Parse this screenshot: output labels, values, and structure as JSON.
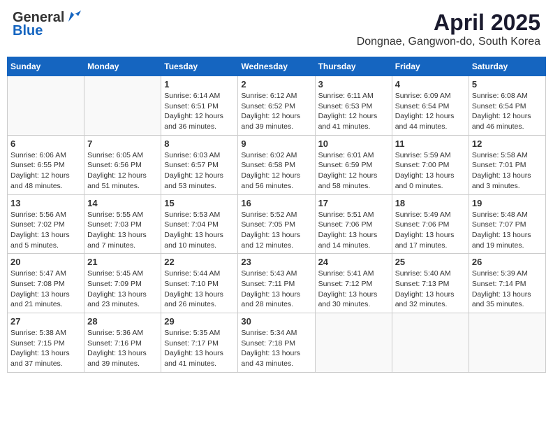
{
  "header": {
    "logo_general": "General",
    "logo_blue": "Blue",
    "title": "April 2025",
    "location": "Dongnae, Gangwon-do, South Korea"
  },
  "calendar": {
    "weekdays": [
      "Sunday",
      "Monday",
      "Tuesday",
      "Wednesday",
      "Thursday",
      "Friday",
      "Saturday"
    ],
    "days": [
      {
        "date": "",
        "info": ""
      },
      {
        "date": "",
        "info": ""
      },
      {
        "date": "1",
        "info": "Sunrise: 6:14 AM\nSunset: 6:51 PM\nDaylight: 12 hours and 36 minutes."
      },
      {
        "date": "2",
        "info": "Sunrise: 6:12 AM\nSunset: 6:52 PM\nDaylight: 12 hours and 39 minutes."
      },
      {
        "date": "3",
        "info": "Sunrise: 6:11 AM\nSunset: 6:53 PM\nDaylight: 12 hours and 41 minutes."
      },
      {
        "date": "4",
        "info": "Sunrise: 6:09 AM\nSunset: 6:54 PM\nDaylight: 12 hours and 44 minutes."
      },
      {
        "date": "5",
        "info": "Sunrise: 6:08 AM\nSunset: 6:54 PM\nDaylight: 12 hours and 46 minutes."
      },
      {
        "date": "6",
        "info": "Sunrise: 6:06 AM\nSunset: 6:55 PM\nDaylight: 12 hours and 48 minutes."
      },
      {
        "date": "7",
        "info": "Sunrise: 6:05 AM\nSunset: 6:56 PM\nDaylight: 12 hours and 51 minutes."
      },
      {
        "date": "8",
        "info": "Sunrise: 6:03 AM\nSunset: 6:57 PM\nDaylight: 12 hours and 53 minutes."
      },
      {
        "date": "9",
        "info": "Sunrise: 6:02 AM\nSunset: 6:58 PM\nDaylight: 12 hours and 56 minutes."
      },
      {
        "date": "10",
        "info": "Sunrise: 6:01 AM\nSunset: 6:59 PM\nDaylight: 12 hours and 58 minutes."
      },
      {
        "date": "11",
        "info": "Sunrise: 5:59 AM\nSunset: 7:00 PM\nDaylight: 13 hours and 0 minutes."
      },
      {
        "date": "12",
        "info": "Sunrise: 5:58 AM\nSunset: 7:01 PM\nDaylight: 13 hours and 3 minutes."
      },
      {
        "date": "13",
        "info": "Sunrise: 5:56 AM\nSunset: 7:02 PM\nDaylight: 13 hours and 5 minutes."
      },
      {
        "date": "14",
        "info": "Sunrise: 5:55 AM\nSunset: 7:03 PM\nDaylight: 13 hours and 7 minutes."
      },
      {
        "date": "15",
        "info": "Sunrise: 5:53 AM\nSunset: 7:04 PM\nDaylight: 13 hours and 10 minutes."
      },
      {
        "date": "16",
        "info": "Sunrise: 5:52 AM\nSunset: 7:05 PM\nDaylight: 13 hours and 12 minutes."
      },
      {
        "date": "17",
        "info": "Sunrise: 5:51 AM\nSunset: 7:06 PM\nDaylight: 13 hours and 14 minutes."
      },
      {
        "date": "18",
        "info": "Sunrise: 5:49 AM\nSunset: 7:06 PM\nDaylight: 13 hours and 17 minutes."
      },
      {
        "date": "19",
        "info": "Sunrise: 5:48 AM\nSunset: 7:07 PM\nDaylight: 13 hours and 19 minutes."
      },
      {
        "date": "20",
        "info": "Sunrise: 5:47 AM\nSunset: 7:08 PM\nDaylight: 13 hours and 21 minutes."
      },
      {
        "date": "21",
        "info": "Sunrise: 5:45 AM\nSunset: 7:09 PM\nDaylight: 13 hours and 23 minutes."
      },
      {
        "date": "22",
        "info": "Sunrise: 5:44 AM\nSunset: 7:10 PM\nDaylight: 13 hours and 26 minutes."
      },
      {
        "date": "23",
        "info": "Sunrise: 5:43 AM\nSunset: 7:11 PM\nDaylight: 13 hours and 28 minutes."
      },
      {
        "date": "24",
        "info": "Sunrise: 5:41 AM\nSunset: 7:12 PM\nDaylight: 13 hours and 30 minutes."
      },
      {
        "date": "25",
        "info": "Sunrise: 5:40 AM\nSunset: 7:13 PM\nDaylight: 13 hours and 32 minutes."
      },
      {
        "date": "26",
        "info": "Sunrise: 5:39 AM\nSunset: 7:14 PM\nDaylight: 13 hours and 35 minutes."
      },
      {
        "date": "27",
        "info": "Sunrise: 5:38 AM\nSunset: 7:15 PM\nDaylight: 13 hours and 37 minutes."
      },
      {
        "date": "28",
        "info": "Sunrise: 5:36 AM\nSunset: 7:16 PM\nDaylight: 13 hours and 39 minutes."
      },
      {
        "date": "29",
        "info": "Sunrise: 5:35 AM\nSunset: 7:17 PM\nDaylight: 13 hours and 41 minutes."
      },
      {
        "date": "30",
        "info": "Sunrise: 5:34 AM\nSunset: 7:18 PM\nDaylight: 13 hours and 43 minutes."
      },
      {
        "date": "",
        "info": ""
      },
      {
        "date": "",
        "info": ""
      },
      {
        "date": "",
        "info": ""
      }
    ]
  }
}
